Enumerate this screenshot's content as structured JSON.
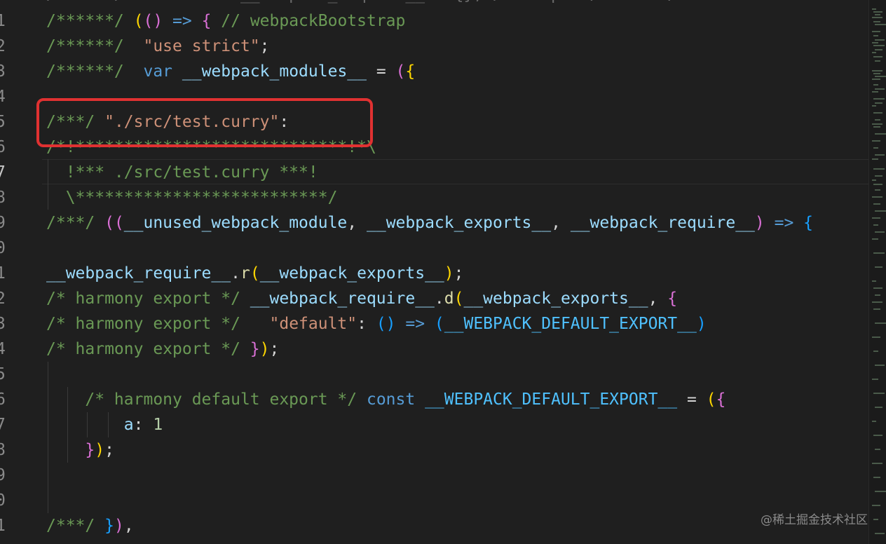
{
  "editor": {
    "top_partial": "/******/ \tvar __webpack_require__ = {}; /* webpack/runtime/...",
    "lines": [
      {
        "num": "1",
        "parts": [
          [
            "comment",
            "/******/ "
          ],
          [
            "brace1",
            "("
          ],
          [
            "brace2",
            "()"
          ],
          [
            "keyword",
            " => "
          ],
          [
            "brace2",
            "{"
          ],
          [
            "comment",
            " // webpackBootstrap"
          ]
        ]
      },
      {
        "num": "2",
        "parts": [
          [
            "comment",
            "/******/ "
          ],
          [
            "punct",
            " "
          ],
          [
            "string",
            "\"use strict\""
          ],
          [
            "punct",
            ";"
          ]
        ]
      },
      {
        "num": "3",
        "parts": [
          [
            "comment",
            "/******/ "
          ],
          [
            "punct",
            " "
          ],
          [
            "keyword",
            "var"
          ],
          [
            "punct",
            " "
          ],
          [
            "var",
            "__webpack_modules__"
          ],
          [
            "punct",
            " = "
          ],
          [
            "brace2",
            "("
          ],
          [
            "brace1",
            "{"
          ]
        ]
      },
      {
        "num": "4",
        "parts": []
      },
      {
        "num": "5",
        "parts": [
          [
            "comment",
            "/***/ "
          ],
          [
            "string",
            "\"./src/test.curry\""
          ],
          [
            "punct",
            ":"
          ]
        ]
      },
      {
        "num": "6",
        "parts": [
          [
            "comment",
            "/*!****************************!*\\"
          ]
        ]
      },
      {
        "num": "7",
        "parts": [
          [
            "comment",
            "  !*** ./src/test.curry ***!"
          ]
        ]
      },
      {
        "num": "8",
        "parts": [
          [
            "comment",
            "  \\**************************/"
          ]
        ]
      },
      {
        "num": "9",
        "parts": [
          [
            "comment",
            "/***/ "
          ],
          [
            "brace2",
            "(("
          ],
          [
            "var",
            "__unused_webpack_module"
          ],
          [
            "punct",
            ", "
          ],
          [
            "var",
            "__webpack_exports__"
          ],
          [
            "punct",
            ", "
          ],
          [
            "var",
            "__webpack_require__"
          ],
          [
            "brace2",
            ")"
          ],
          [
            "keyword",
            " => "
          ],
          [
            "brace3",
            "{"
          ]
        ]
      },
      {
        "num": "0",
        "parts": []
      },
      {
        "num": "1",
        "parts": [
          [
            "var",
            "__webpack_require__"
          ],
          [
            "punct",
            "."
          ],
          [
            "fn",
            "r"
          ],
          [
            "brace1",
            "("
          ],
          [
            "var",
            "__webpack_exports__"
          ],
          [
            "brace1",
            ")"
          ],
          [
            "punct",
            ";"
          ]
        ]
      },
      {
        "num": "2",
        "parts": [
          [
            "comment",
            "/* harmony export */ "
          ],
          [
            "var",
            "__webpack_require__"
          ],
          [
            "punct",
            "."
          ],
          [
            "fn",
            "d"
          ],
          [
            "brace1",
            "("
          ],
          [
            "var",
            "__webpack_exports__"
          ],
          [
            "punct",
            ", "
          ],
          [
            "brace2",
            "{"
          ]
        ]
      },
      {
        "num": "3",
        "parts": [
          [
            "comment",
            "/* harmony export */ "
          ],
          [
            "punct",
            "  "
          ],
          [
            "string",
            "\"default\""
          ],
          [
            "punct",
            ": "
          ],
          [
            "brace3",
            "()"
          ],
          [
            "keyword",
            " => "
          ],
          [
            "brace3",
            "("
          ],
          [
            "const",
            "__WEBPACK_DEFAULT_EXPORT__"
          ],
          [
            "brace3",
            ")"
          ]
        ]
      },
      {
        "num": "4",
        "parts": [
          [
            "comment",
            "/* harmony export */ "
          ],
          [
            "brace2",
            "}"
          ],
          [
            "brace1",
            ")"
          ],
          [
            "punct",
            ";"
          ]
        ]
      },
      {
        "num": "5",
        "parts": []
      },
      {
        "num": "6",
        "parts": [
          [
            "punct",
            "    "
          ],
          [
            "comment",
            "/* harmony default export */ "
          ],
          [
            "keyword",
            "const"
          ],
          [
            "punct",
            " "
          ],
          [
            "const",
            "__WEBPACK_DEFAULT_EXPORT__"
          ],
          [
            "punct",
            " = "
          ],
          [
            "brace1",
            "("
          ],
          [
            "brace2",
            "{"
          ]
        ]
      },
      {
        "num": "7",
        "parts": [
          [
            "punct",
            "        "
          ],
          [
            "var",
            "a"
          ],
          [
            "punct",
            ": "
          ],
          [
            "number",
            "1"
          ]
        ]
      },
      {
        "num": "8",
        "parts": [
          [
            "punct",
            "    "
          ],
          [
            "brace2",
            "}"
          ],
          [
            "brace1",
            ")"
          ],
          [
            "punct",
            ";"
          ]
        ]
      },
      {
        "num": "9",
        "parts": []
      },
      {
        "num": "0",
        "parts": []
      },
      {
        "num": "1",
        "parts": [
          [
            "comment",
            "/***/ "
          ],
          [
            "brace3",
            "}"
          ],
          [
            "brace2",
            ")"
          ],
          [
            "punct",
            ","
          ]
        ]
      }
    ],
    "active_line_index": 6
  },
  "watermark": "@稀土掘金技术社区",
  "colors": {
    "background": "#1f1f1f",
    "annotation_box": "#e03131"
  }
}
